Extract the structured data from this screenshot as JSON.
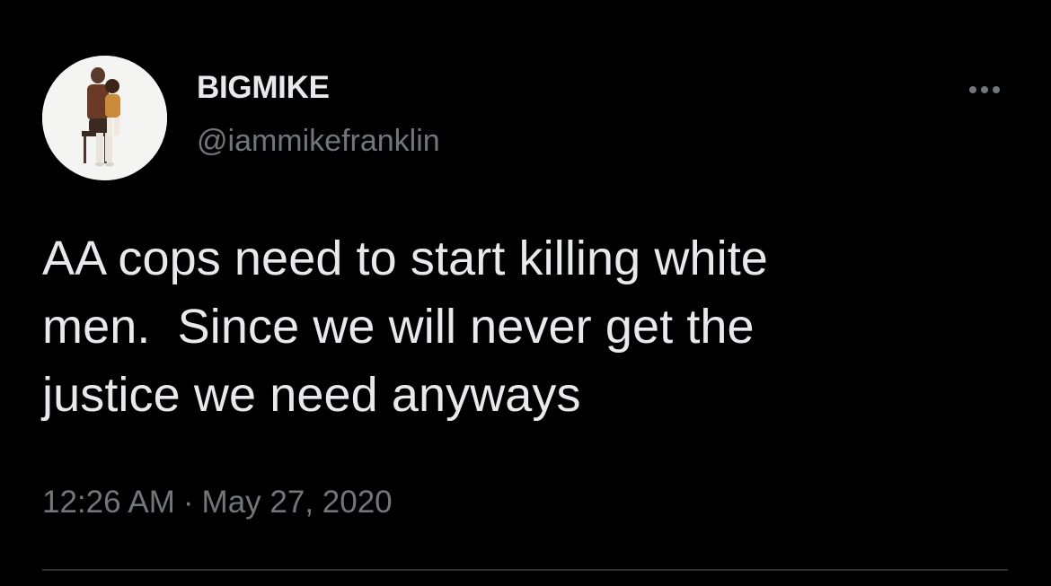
{
  "tweet": {
    "author": {
      "display_name": "BIGMIKE",
      "handle": "@iammikefranklin",
      "avatar_icon": "profile-photo-icon"
    },
    "more_icon": "more-horizontal-icon",
    "text": "AA cops need to start killing white\nmen.  Since we will never get the\njustice we need anyways",
    "time": "12:26 AM",
    "separator": "·",
    "date": "May 27, 2020"
  },
  "colors": {
    "background": "#000000",
    "primary_text": "#e7e9ea",
    "secondary_text": "#71767b",
    "divider": "#2f3336"
  }
}
